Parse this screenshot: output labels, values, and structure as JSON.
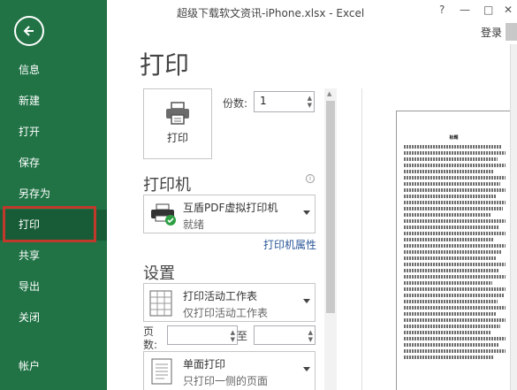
{
  "window": {
    "title": "超级下载软文资讯-iPhone.xlsx - Excel",
    "help": "?",
    "minimize": "—",
    "maximize": "□",
    "close": "✕",
    "login": "登录"
  },
  "sidebar": {
    "items": [
      {
        "label": "信息"
      },
      {
        "label": "新建"
      },
      {
        "label": "打开"
      },
      {
        "label": "保存"
      },
      {
        "label": "另存为"
      },
      {
        "label": "打印"
      },
      {
        "label": "共享"
      },
      {
        "label": "导出"
      },
      {
        "label": "关闭"
      },
      {
        "label": "帐户"
      }
    ],
    "active": "打印"
  },
  "print": {
    "heading": "打印",
    "print_button": "打印",
    "copies_label": "份数:",
    "copies_value": "1",
    "printer_heading": "打印机",
    "printer_name": "互盾PDF虚拟打印机",
    "printer_status": "就绪",
    "printer_properties": "打印机属性",
    "settings_heading": "设置",
    "scope_main": "打印活动工作表",
    "scope_sub": "仅打印活动工作表",
    "pages_label_1": "页",
    "pages_label_2": "数:",
    "pages_to": "至",
    "sides_main": "单面打印",
    "sides_sub": "只打印一侧的页面"
  },
  "preview": {
    "title": "标题"
  },
  "colors": {
    "accent": "#217346",
    "active_item": "#185c37",
    "highlight": "#c0392b",
    "link": "#2b579a"
  }
}
